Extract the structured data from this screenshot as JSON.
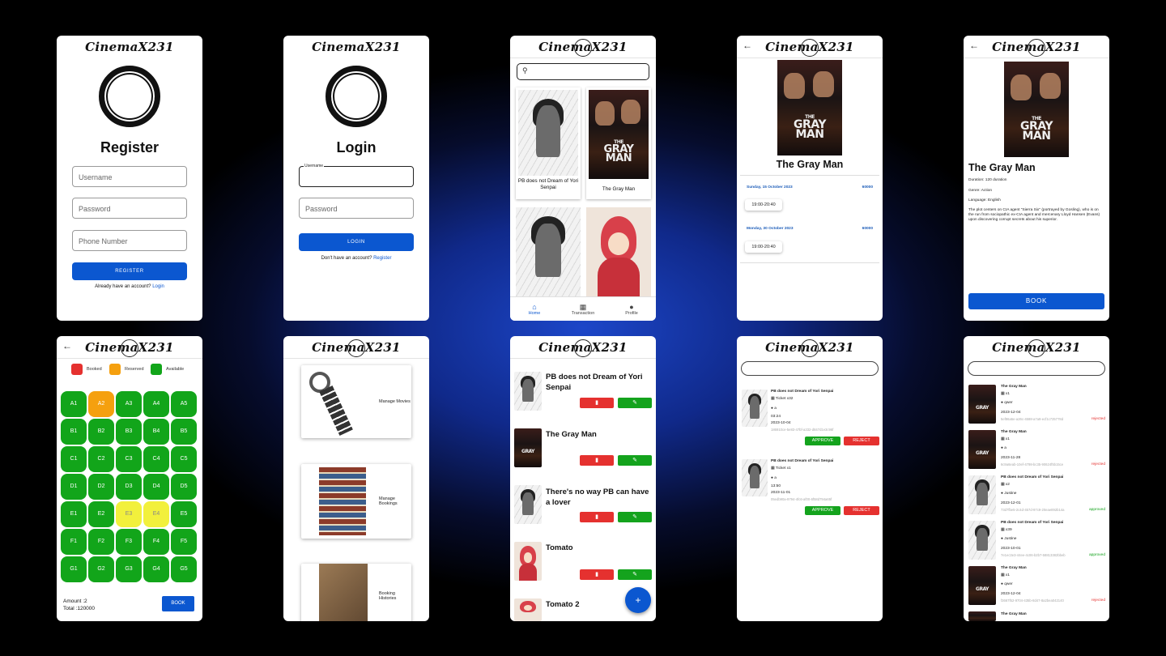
{
  "app": {
    "logo": "CinemaX231"
  },
  "register": {
    "title": "Register",
    "username_ph": "Username",
    "password_ph": "Password",
    "phone_ph": "Phone Number",
    "button": "REGISTER",
    "footer_text": "Already have an account?",
    "footer_link": "Login"
  },
  "login": {
    "title": "Login",
    "username_label": "Username",
    "password_ph": "Password",
    "button": "LOGIN",
    "footer_text": "Don't have an account?",
    "footer_link": "Register"
  },
  "home": {
    "movies": [
      {
        "title": "PB does not Dream of Yori Senpai"
      },
      {
        "title": "The Gray Man"
      }
    ],
    "nav": [
      "Home",
      "Transaction",
      "Profile"
    ]
  },
  "poster": {
    "line1": "THE",
    "line2": "GRAY",
    "line3": "MAN"
  },
  "schedule": {
    "movie_title": "The Gray Man",
    "days": [
      {
        "date": "Sunday, 15 October 2023",
        "price": "60000",
        "time": "19:00-20:40"
      },
      {
        "date": "Monday, 30 October 2023",
        "price": "60000",
        "time": "19:00-20:40"
      }
    ]
  },
  "detail": {
    "title": "The Gray Man",
    "duration": "Duration: 120 duration",
    "genre": "Genre: Action",
    "language": "Language: English",
    "synopsis": "The plot centers on CIA agent \"Sierra Six\" (portrayed by Gosling), who is on the run from sociopathic ex-CIA agent and mercenary Lloyd Hansen (Evans) upon discovering corrupt secrets about his superior.",
    "button": "BOOK"
  },
  "seats": {
    "legend": [
      "Booked",
      "Reserved",
      "Available"
    ],
    "rows": [
      [
        "A1",
        "A2",
        "A3",
        "A4",
        "A5"
      ],
      [
        "B1",
        "B2",
        "B3",
        "B4",
        "B5"
      ],
      [
        "C1",
        "C2",
        "C3",
        "C4",
        "C5"
      ],
      [
        "D1",
        "D2",
        "D3",
        "D4",
        "D5"
      ],
      [
        "E1",
        "E2",
        "E3",
        "E4",
        "E5"
      ],
      [
        "F1",
        "F2",
        "F3",
        "F4",
        "F5"
      ],
      [
        "G1",
        "G2",
        "G3",
        "G4",
        "G5"
      ]
    ],
    "amount": "Amount :2",
    "total": "Total :120000",
    "button": "BOOK",
    "colors": {
      "available": "#12a51a",
      "reserved": "#f5a00f",
      "selected": "#f2f03c",
      "booked": "#e5312f"
    }
  },
  "admin": {
    "items": [
      "Manage Movies",
      "Manage Bookings",
      "Booking Histories"
    ]
  },
  "manage_movies": {
    "items": [
      "PB does not Dream of Yori Senpai",
      "The Gray Man",
      "There's no way PB can have a lover",
      "Tomato",
      "Tomato 2"
    ]
  },
  "bookings": [
    {
      "title": "PB does not Dream of Yori Senpai",
      "ticket": "Ticket x32",
      "user": "a",
      "time": "03:24",
      "date": "2023-10-04",
      "id": "186910ce-5e83-47bf-a332-d847d1e3c96f"
    },
    {
      "title": "PB does not Dream of Yori Senpai",
      "ticket": "Ticket x1",
      "user": "a",
      "time": "13:50",
      "date": "2023-11-01",
      "id": "05edb90a-9794-4fc6-af00-6f58d794a65f"
    }
  ],
  "booking_actions": {
    "approve": "APPROVE",
    "reject": "REJECT"
  },
  "history": [
    {
      "title": "The Gray Man",
      "count": "x1",
      "user": "qwer",
      "date": "2023-12-04",
      "id": "5ef86a5e-a26c-4588-a7a9-ecf1c725778d",
      "status": "rejected"
    },
    {
      "title": "The Gray Man",
      "count": "x1",
      "user": "a",
      "date": "2023-11-28",
      "id": "6c9a6eab-10ef-4798-bc35-90624f5b15ce",
      "status": "rejected"
    },
    {
      "title": "PB does not Dream of Yori Senpai",
      "count": "x2",
      "user": "Justine",
      "date": "2023-12-01",
      "id": "73d7fbe5-2c4d-457d-97c9-20eae892b14a",
      "status": "approved"
    },
    {
      "title": "PB does not Dream of Yori Senpai",
      "count": "x39",
      "user": "Justine",
      "date": "2023-10-01",
      "id": "7e1ec3e3-44ee-4c06-b2b7-58813382bbeb",
      "status": "approved"
    },
    {
      "title": "The Gray Man",
      "count": "x1",
      "user": "qwer",
      "date": "2023-12-04",
      "id": "f3667f52-9704-435b-8d47-8a2bea042140",
      "status": "rejected"
    },
    {
      "title": "The Gray Man"
    }
  ]
}
